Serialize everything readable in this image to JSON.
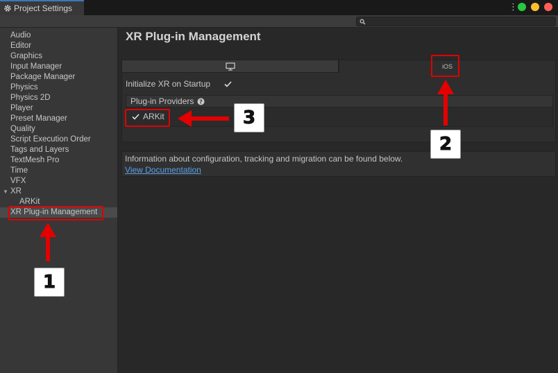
{
  "window": {
    "tab_title": "Project Settings",
    "controls": {
      "green": "#27c93f",
      "yellow": "#ffbd2e",
      "red": "#ff5f56"
    }
  },
  "sidebar": {
    "items": [
      {
        "label": "Audio"
      },
      {
        "label": "Editor"
      },
      {
        "label": "Graphics"
      },
      {
        "label": "Input Manager"
      },
      {
        "label": "Package Manager"
      },
      {
        "label": "Physics"
      },
      {
        "label": "Physics 2D"
      },
      {
        "label": "Player"
      },
      {
        "label": "Preset Manager"
      },
      {
        "label": "Quality"
      },
      {
        "label": "Script Execution Order"
      },
      {
        "label": "Tags and Layers"
      },
      {
        "label": "TextMesh Pro"
      },
      {
        "label": "Time"
      },
      {
        "label": "VFX"
      },
      {
        "label": "XR"
      },
      {
        "label": "ARKit"
      },
      {
        "label": "XR Plug-in Management"
      }
    ]
  },
  "main": {
    "title": "XR Plug-in Management",
    "platform_tabs": [
      {
        "icon": "desktop-icon",
        "label": ""
      },
      {
        "icon": "",
        "label": "iOS"
      }
    ],
    "init_label": "Initialize XR on Startup",
    "init_checked": true,
    "providers_label": "Plug-in Providers",
    "providers": [
      {
        "label": "ARKit",
        "checked": true
      }
    ],
    "info_text": "Information about configuration, tracking and migration can be found below.",
    "info_link": "View Documentation"
  },
  "annotations": {
    "callout_1": "1",
    "callout_2": "2",
    "callout_3": "3",
    "color": "#e30000"
  }
}
